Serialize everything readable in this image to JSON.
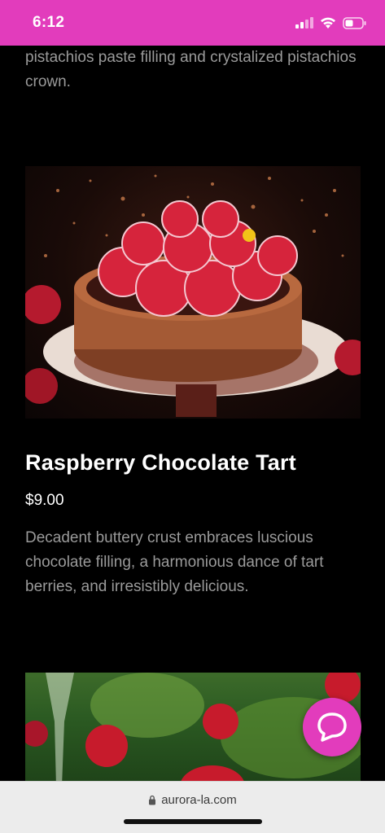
{
  "status_bar": {
    "time": "6:12",
    "background": "#e23cbc",
    "icons": [
      "signal-icon",
      "wifi-icon",
      "battery-icon"
    ]
  },
  "previous_item": {
    "description": "pistachios paste filling and crystalized pistachios crown."
  },
  "product": {
    "image_label": "raspberry-chocolate-tart-photo",
    "title": "Raspberry Chocolate Tart",
    "price": "$9.00",
    "description": "Decadent buttery crust embraces luscious chocolate filling, a harmonious dance of tart berries, and irresistibly delicious."
  },
  "next_item": {
    "image_label": "raspberry-champagne-photo"
  },
  "chat": {
    "icon": "chat-bubble-icon",
    "color": "#e23cbc"
  },
  "browser": {
    "url": "aurora-la.com",
    "icon": "lock-icon"
  }
}
